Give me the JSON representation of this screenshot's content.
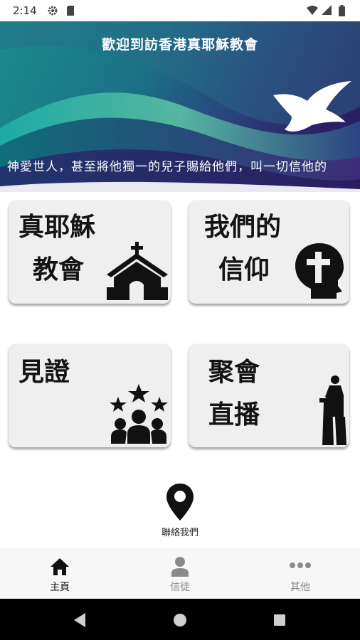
{
  "status_bar": {
    "time": "2:14"
  },
  "banner": {
    "title": "歡迎到訪香港真耶穌教會",
    "marquee": "神愛世人，甚至將他獨一的兒子賜給他們，叫一切信他的"
  },
  "tiles": [
    {
      "line1": "真耶穌",
      "line2": "教會",
      "icon": "church-icon"
    },
    {
      "line1": "我們的",
      "line2": "信仰",
      "icon": "faith-head-cross-icon"
    },
    {
      "line1": "見證",
      "line2": "",
      "icon": "people-stars-icon"
    },
    {
      "line1": "聚會",
      "line2": "直播",
      "icon": "preacher-pulpit-icon"
    }
  ],
  "contact": {
    "label": "聯絡我們",
    "icon": "location-pin-icon"
  },
  "bottom_nav": {
    "items": [
      {
        "label": "主頁",
        "icon": "home-icon",
        "active": true
      },
      {
        "label": "信徒",
        "icon": "person-icon",
        "active": false
      },
      {
        "label": "其他",
        "icon": "more-icon",
        "active": false
      }
    ]
  },
  "colors": {
    "active": "#111111",
    "inactive": "#8a8a8a",
    "banner_deep": "#2a1f63",
    "banner_teal": "#1a8c8c"
  }
}
